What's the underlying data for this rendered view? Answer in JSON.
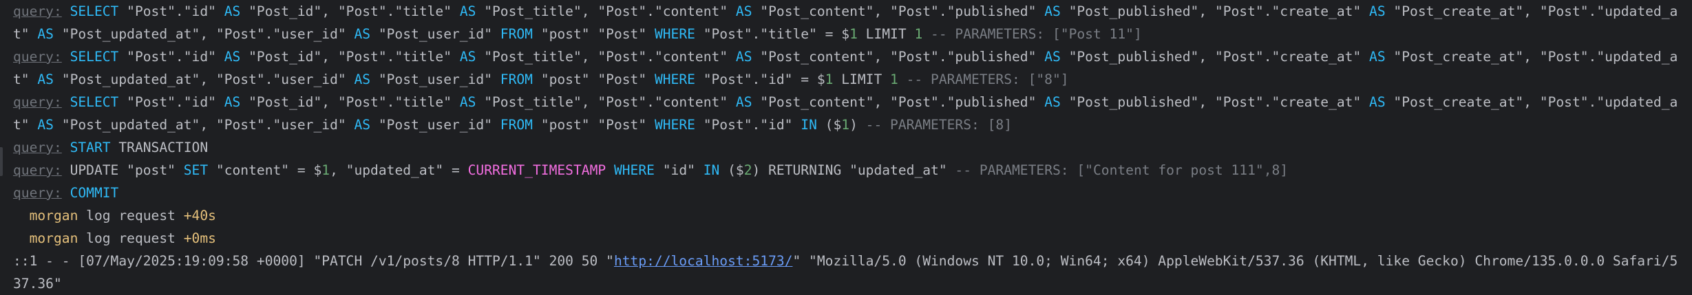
{
  "console": {
    "lines": [
      {
        "name": "query-log-select-by-title",
        "tokens": [
          {
            "t": "query:",
            "k": "query"
          },
          {
            "t": " "
          },
          {
            "t": "SELECT",
            "k": "kw"
          },
          {
            "t": " \"Post\".\"id\" "
          },
          {
            "t": "AS",
            "k": "kw"
          },
          {
            "t": " \"Post_id\", \"Post\".\"title\" "
          },
          {
            "t": "AS",
            "k": "kw"
          },
          {
            "t": " \"Post_title\", \"Post\".\"content\" "
          },
          {
            "t": "AS",
            "k": "kw"
          },
          {
            "t": " \"Post_content\", \"Post\".\"published\" "
          },
          {
            "t": "AS",
            "k": "kw"
          },
          {
            "t": " \"Post_published\", \"Post\".\"create_at\" "
          },
          {
            "t": "AS",
            "k": "kw"
          },
          {
            "t": " \"Post_create_at\", \"Post\".\"updated_at\" "
          },
          {
            "t": "AS",
            "k": "kw"
          },
          {
            "t": " \"Post_updated_at\", \"Post\".\"user_id\" "
          },
          {
            "t": "AS",
            "k": "kw"
          },
          {
            "t": " \"Post_user_id\" "
          },
          {
            "t": "FROM",
            "k": "kw"
          },
          {
            "t": " \"post\" \"Post\" "
          },
          {
            "t": "WHERE",
            "k": "kw"
          },
          {
            "t": " \"Post\".\"title\" = $"
          },
          {
            "t": "1",
            "k": "num"
          },
          {
            "t": " LIMIT "
          },
          {
            "t": "1",
            "k": "num"
          },
          {
            "t": " -- PARAMETERS: [\"Post 11\"]",
            "k": "comment"
          }
        ]
      },
      {
        "name": "query-log-select-by-id",
        "tokens": [
          {
            "t": "query:",
            "k": "query"
          },
          {
            "t": " "
          },
          {
            "t": "SELECT",
            "k": "kw"
          },
          {
            "t": " \"Post\".\"id\" "
          },
          {
            "t": "AS",
            "k": "kw"
          },
          {
            "t": " \"Post_id\", \"Post\".\"title\" "
          },
          {
            "t": "AS",
            "k": "kw"
          },
          {
            "t": " \"Post_title\", \"Post\".\"content\" "
          },
          {
            "t": "AS",
            "k": "kw"
          },
          {
            "t": " \"Post_content\", \"Post\".\"published\" "
          },
          {
            "t": "AS",
            "k": "kw"
          },
          {
            "t": " \"Post_published\", \"Post\".\"create_at\" "
          },
          {
            "t": "AS",
            "k": "kw"
          },
          {
            "t": " \"Post_create_at\", \"Post\".\"updated_at\" "
          },
          {
            "t": "AS",
            "k": "kw"
          },
          {
            "t": " \"Post_updated_at\", \"Post\".\"user_id\" "
          },
          {
            "t": "AS",
            "k": "kw"
          },
          {
            "t": " \"Post_user_id\" "
          },
          {
            "t": "FROM",
            "k": "kw"
          },
          {
            "t": " \"post\" \"Post\" "
          },
          {
            "t": "WHERE",
            "k": "kw"
          },
          {
            "t": " \"Post\".\"id\" = $"
          },
          {
            "t": "1",
            "k": "num"
          },
          {
            "t": " LIMIT "
          },
          {
            "t": "1",
            "k": "num"
          },
          {
            "t": " -- PARAMETERS: [\"8\"]",
            "k": "comment"
          }
        ]
      },
      {
        "name": "query-log-select-in",
        "tokens": [
          {
            "t": "query:",
            "k": "query"
          },
          {
            "t": " "
          },
          {
            "t": "SELECT",
            "k": "kw"
          },
          {
            "t": " \"Post\".\"id\" "
          },
          {
            "t": "AS",
            "k": "kw"
          },
          {
            "t": " \"Post_id\", \"Post\".\"title\" "
          },
          {
            "t": "AS",
            "k": "kw"
          },
          {
            "t": " \"Post_title\", \"Post\".\"content\" "
          },
          {
            "t": "AS",
            "k": "kw"
          },
          {
            "t": " \"Post_content\", \"Post\".\"published\" "
          },
          {
            "t": "AS",
            "k": "kw"
          },
          {
            "t": " \"Post_published\", \"Post\".\"create_at\" "
          },
          {
            "t": "AS",
            "k": "kw"
          },
          {
            "t": " \"Post_create_at\", \"Post\".\"updated_at\" "
          },
          {
            "t": "AS",
            "k": "kw"
          },
          {
            "t": " \"Post_updated_at\", \"Post\".\"user_id\" "
          },
          {
            "t": "AS",
            "k": "kw"
          },
          {
            "t": " \"Post_user_id\" "
          },
          {
            "t": "FROM",
            "k": "kw"
          },
          {
            "t": " \"post\" \"Post\" "
          },
          {
            "t": "WHERE",
            "k": "kw"
          },
          {
            "t": " \"Post\".\"id\" "
          },
          {
            "t": "IN",
            "k": "kw"
          },
          {
            "t": " ($"
          },
          {
            "t": "1",
            "k": "num"
          },
          {
            "t": ")"
          },
          {
            "t": " -- PARAMETERS: [8]",
            "k": "comment"
          }
        ]
      },
      {
        "name": "query-log-start-transaction",
        "tokens": [
          {
            "t": "query:",
            "k": "query"
          },
          {
            "t": " "
          },
          {
            "t": "START",
            "k": "kw"
          },
          {
            "t": " TRANSACTION"
          }
        ]
      },
      {
        "name": "query-log-update",
        "tokens": [
          {
            "t": "query:",
            "k": "query"
          },
          {
            "t": " UPDATE \"post\" "
          },
          {
            "t": "SET",
            "k": "kw"
          },
          {
            "t": " \"content\" = $"
          },
          {
            "t": "1",
            "k": "num"
          },
          {
            "t": ", \"updated_at\" = "
          },
          {
            "t": "CURRENT_TIMESTAMP",
            "k": "fn"
          },
          {
            "t": " "
          },
          {
            "t": "WHERE",
            "k": "kw"
          },
          {
            "t": " \"id\" "
          },
          {
            "t": "IN",
            "k": "kw"
          },
          {
            "t": " ($"
          },
          {
            "t": "2",
            "k": "num"
          },
          {
            "t": ") RETURNING \"updated_at\""
          },
          {
            "t": " -- PARAMETERS: [\"Content for post 111\",8]",
            "k": "comment"
          }
        ]
      },
      {
        "name": "query-log-commit",
        "tokens": [
          {
            "t": "query:",
            "k": "query"
          },
          {
            "t": " "
          },
          {
            "t": "COMMIT",
            "k": "kw"
          }
        ]
      },
      {
        "name": "morgan-log-line-1",
        "tokens": [
          {
            "t": "  "
          },
          {
            "t": "morgan",
            "k": "morgan"
          },
          {
            "t": " log request "
          },
          {
            "t": "+40s",
            "k": "morgan"
          }
        ]
      },
      {
        "name": "morgan-log-line-2",
        "tokens": [
          {
            "t": "  "
          },
          {
            "t": "morgan",
            "k": "morgan"
          },
          {
            "t": " log request "
          },
          {
            "t": "+0ms",
            "k": "morgan"
          }
        ]
      },
      {
        "name": "access-log-line",
        "tokens": [
          {
            "t": "::1 - - [07/May/2025:19:09:58 +0000] \"PATCH /v1/posts/8 HTTP/1.1\" 200 50 \""
          },
          {
            "t": "http://localhost:5173/",
            "k": "link"
          },
          {
            "t": "\" \"Mozilla/5.0 (Windows NT 10.0; Win64; x64) AppleWebKit/537.36 (KHTML, like Gecko) Chrome/135.0.0.0 Safari/537.36\""
          }
        ]
      }
    ]
  }
}
